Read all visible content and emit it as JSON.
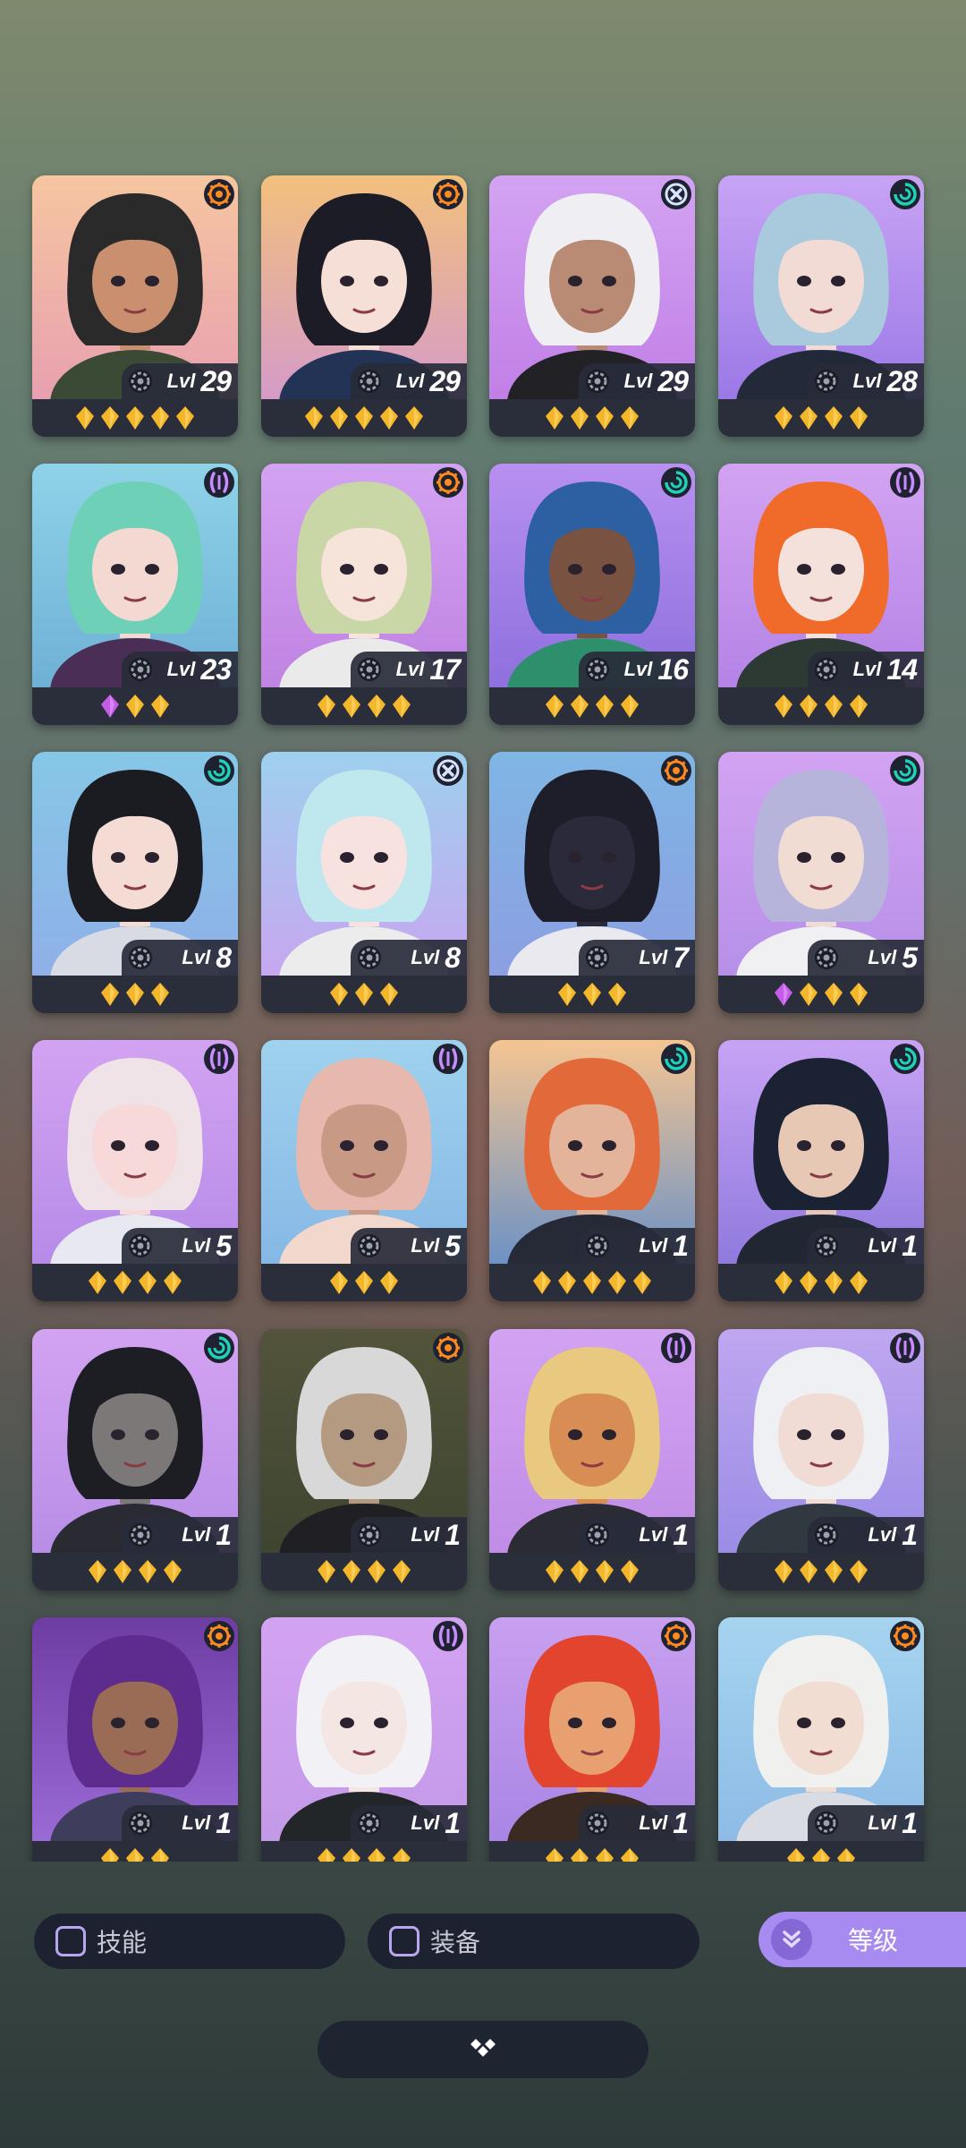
{
  "cards": [
    {
      "class": "orange",
      "lvl_prefix": "Lvl",
      "level": "29",
      "stars": 5,
      "gems": 0,
      "bg1": "#f6c6a0",
      "bg2": "#e8a0b0",
      "hair": "#2b2a2b",
      "skin": "#c98f6f",
      "top": "#3a4a34"
    },
    {
      "class": "orange",
      "lvl_prefix": "Lvl",
      "level": "29",
      "stars": 5,
      "gems": 0,
      "bg1": "#f3c07d",
      "bg2": "#d59bc8",
      "hair": "#1c1c26",
      "skin": "#f6dfd6",
      "top": "#223355"
    },
    {
      "class": "cross",
      "lvl_prefix": "Lvl",
      "level": "29",
      "stars": 4,
      "gems": 0,
      "bg1": "#d3a3f2",
      "bg2": "#c17fe6",
      "hair": "#efeff3",
      "skin": "#b98a74",
      "top": "#222226"
    },
    {
      "class": "teal",
      "lvl_prefix": "Lvl",
      "level": "28",
      "stars": 4,
      "gems": 0,
      "bg1": "#c8a3f5",
      "bg2": "#9b79e6",
      "hair": "#a9c9dd",
      "skin": "#f1dbd4",
      "top": "#222a3a"
    },
    {
      "class": "purple",
      "lvl_prefix": "Lvl",
      "level": "23",
      "stars": 2,
      "gems": 1,
      "bg1": "#8fd3e8",
      "bg2": "#6fb0d6",
      "hair": "#6fd0b8",
      "skin": "#f4d9d2",
      "top": "#4b2e55"
    },
    {
      "class": "orange",
      "lvl_prefix": "Lvl",
      "level": "17",
      "stars": 4,
      "gems": 0,
      "bg1": "#d3a3f2",
      "bg2": "#c083e2",
      "hair": "#c9d6a5",
      "skin": "#f6e3da",
      "top": "#eaeaea"
    },
    {
      "class": "teal",
      "lvl_prefix": "Lvl",
      "level": "16",
      "stars": 4,
      "gems": 0,
      "bg1": "#b890f0",
      "bg2": "#8e70de",
      "hair": "#2d5fa3",
      "skin": "#7a5242",
      "top": "#2e8f6c"
    },
    {
      "class": "purple",
      "lvl_prefix": "Lvl",
      "level": "14",
      "stars": 4,
      "gems": 0,
      "bg1": "#d3a3f2",
      "bg2": "#b483e6",
      "hair": "#f06a2a",
      "skin": "#f4e1dc",
      "top": "#2c3a33"
    },
    {
      "class": "teal",
      "lvl_prefix": "Lvl",
      "level": "8",
      "stars": 3,
      "gems": 0,
      "bg1": "#86c7e6",
      "bg2": "#8fb0e8",
      "hair": "#1b1b22",
      "skin": "#f4dcd4",
      "top": "#d8dbe3"
    },
    {
      "class": "cross",
      "lvl_prefix": "Lvl",
      "level": "8",
      "stars": 3,
      "gems": 0,
      "bg1": "#9ed0ee",
      "bg2": "#c7a7f0",
      "hair": "#bfe8ee",
      "skin": "#f8e2e0",
      "top": "#ececec"
    },
    {
      "class": "orange",
      "lvl_prefix": "Lvl",
      "level": "7",
      "stars": 3,
      "gems": 0,
      "bg1": "#7fb6e4",
      "bg2": "#8c9fe2",
      "hair": "#1e1e2a",
      "skin": "#2a2a3a",
      "top": "#e9e9ef"
    },
    {
      "class": "teal",
      "lvl_prefix": "Lvl",
      "level": "5",
      "stars": 3,
      "gems": 1,
      "bg1": "#d3a3f2",
      "bg2": "#b690e8",
      "hair": "#b7b4dc",
      "skin": "#f1dcd4",
      "top": "#f0f0f2"
    },
    {
      "class": "purple",
      "lvl_prefix": "Lvl",
      "level": "5",
      "stars": 4,
      "gems": 0,
      "bg1": "#d3a3f2",
      "bg2": "#b68be8",
      "hair": "#efe3e8",
      "skin": "#f6d9d8",
      "top": "#e8e9f0"
    },
    {
      "class": "purple",
      "lvl_prefix": "Lvl",
      "level": "5",
      "stars": 3,
      "gems": 0,
      "bg1": "#9fd2ee",
      "bg2": "#86b8e6",
      "hair": "#e7b9ae",
      "skin": "#c89a85",
      "top": "#f2d8cc"
    },
    {
      "class": "teal",
      "lvl_prefix": "Lvl",
      "level": "1",
      "stars": 5,
      "gems": 0,
      "bg1": "#f5c592",
      "bg2": "#6d92c5",
      "hair": "#e26a3a",
      "skin": "#e3b49a",
      "top": "#252a36"
    },
    {
      "class": "teal",
      "lvl_prefix": "Lvl",
      "level": "1",
      "stars": 4,
      "gems": 0,
      "bg1": "#c8a3f5",
      "bg2": "#8f7ade",
      "hair": "#1a2233",
      "skin": "#e7c8b4",
      "top": "#212633"
    },
    {
      "class": "teal",
      "lvl_prefix": "Lvl",
      "level": "1",
      "stars": 4,
      "gems": 0,
      "bg1": "#d3a3f2",
      "bg2": "#b88ee6",
      "hair": "#1d1d24",
      "skin": "#7d7878",
      "top": "#2a2a33"
    },
    {
      "class": "orange",
      "lvl_prefix": "Lvl",
      "level": "1",
      "stars": 4,
      "gems": 0,
      "bg1": "#53543a",
      "bg2": "#3e4530",
      "hair": "#d8d8d8",
      "skin": "#b49a80",
      "top": "#1f1f24"
    },
    {
      "class": "purple",
      "lvl_prefix": "Lvl",
      "level": "1",
      "stars": 4,
      "gems": 0,
      "bg1": "#d3a3f2",
      "bg2": "#c08ce6",
      "hair": "#e9c87f",
      "skin": "#d88d55",
      "top": "#2b2b33"
    },
    {
      "class": "purple",
      "lvl_prefix": "Lvl",
      "level": "1",
      "stars": 4,
      "gems": 0,
      "bg1": "#bfa7f0",
      "bg2": "#9b8ce6",
      "hair": "#eef0f4",
      "skin": "#f0dcd4",
      "top": "#303840"
    },
    {
      "class": "orange",
      "lvl_prefix": "Lvl",
      "level": "1",
      "stars": 3,
      "gems": 0,
      "bg1": "#6e3da3",
      "bg2": "#9a6ad6",
      "hair": "#5d2c8e",
      "skin": "#9a6b55",
      "top": "#3e3e5c"
    },
    {
      "class": "purple",
      "lvl_prefix": "Lvl",
      "level": "1",
      "stars": 4,
      "gems": 0,
      "bg1": "#d3a3f2",
      "bg2": "#c39ae8",
      "hair": "#f2f2f6",
      "skin": "#f4e6e2",
      "top": "#232628"
    },
    {
      "class": "orange",
      "lvl_prefix": "Lvl",
      "level": "1",
      "stars": 4,
      "gems": 0,
      "bg1": "#c9a0f0",
      "bg2": "#a985e4",
      "hair": "#e2442e",
      "skin": "#e9a070",
      "top": "#3a2a22"
    },
    {
      "class": "orange",
      "lvl_prefix": "Lvl",
      "level": "1",
      "stars": 3,
      "gems": 0,
      "bg1": "#a6d4ef",
      "bg2": "#8dbbe6",
      "hair": "#f0f0ee",
      "skin": "#f2ddd2",
      "top": "#d9dde3"
    }
  ],
  "class_colors": {
    "orange": "#ff8a1f",
    "teal": "#1fd1b9",
    "purple": "#c98cff",
    "cross": "#d8e4ff"
  },
  "filters": {
    "skill_label": "技能",
    "equipment_label": "装备",
    "level_label": "等级"
  },
  "bottom_toggle_icon": "diamond-arrows-icon"
}
